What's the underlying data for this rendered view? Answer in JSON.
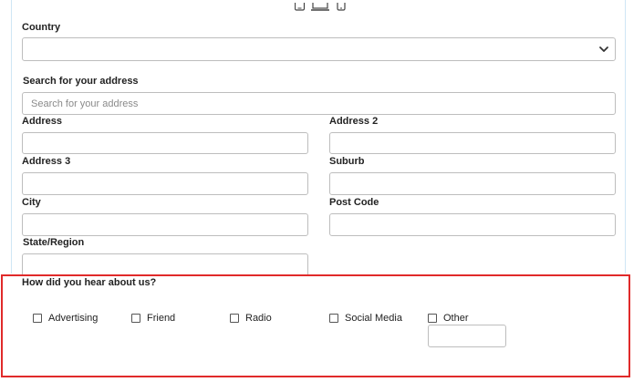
{
  "form": {
    "country_label": "Country",
    "country_value": "",
    "search_label": "Search for your address",
    "search_placeholder": "Search for your address",
    "address_label": "Address",
    "address2_label": "Address 2",
    "address3_label": "Address 3",
    "suburb_label": "Suburb",
    "city_label": "City",
    "postcode_label": "Post Code",
    "state_label": "State/Region",
    "hear_label": "How did you hear about us?",
    "options": [
      {
        "label": "Advertising",
        "checked": false
      },
      {
        "label": "Friend",
        "checked": false
      },
      {
        "label": "Radio",
        "checked": false
      },
      {
        "label": "Social Media",
        "checked": false
      },
      {
        "label": "Other",
        "checked": false
      }
    ],
    "other_value": ""
  },
  "icons": {
    "devices": [
      "tablet-icon",
      "laptop-icon",
      "phone-icon"
    ],
    "select_chevron": "chevron-down-icon"
  },
  "colors": {
    "highlight_border": "#e02a2a",
    "input_border": "#bdbdbd",
    "frame_border": "#cfe6f5",
    "label_text": "#222222"
  }
}
